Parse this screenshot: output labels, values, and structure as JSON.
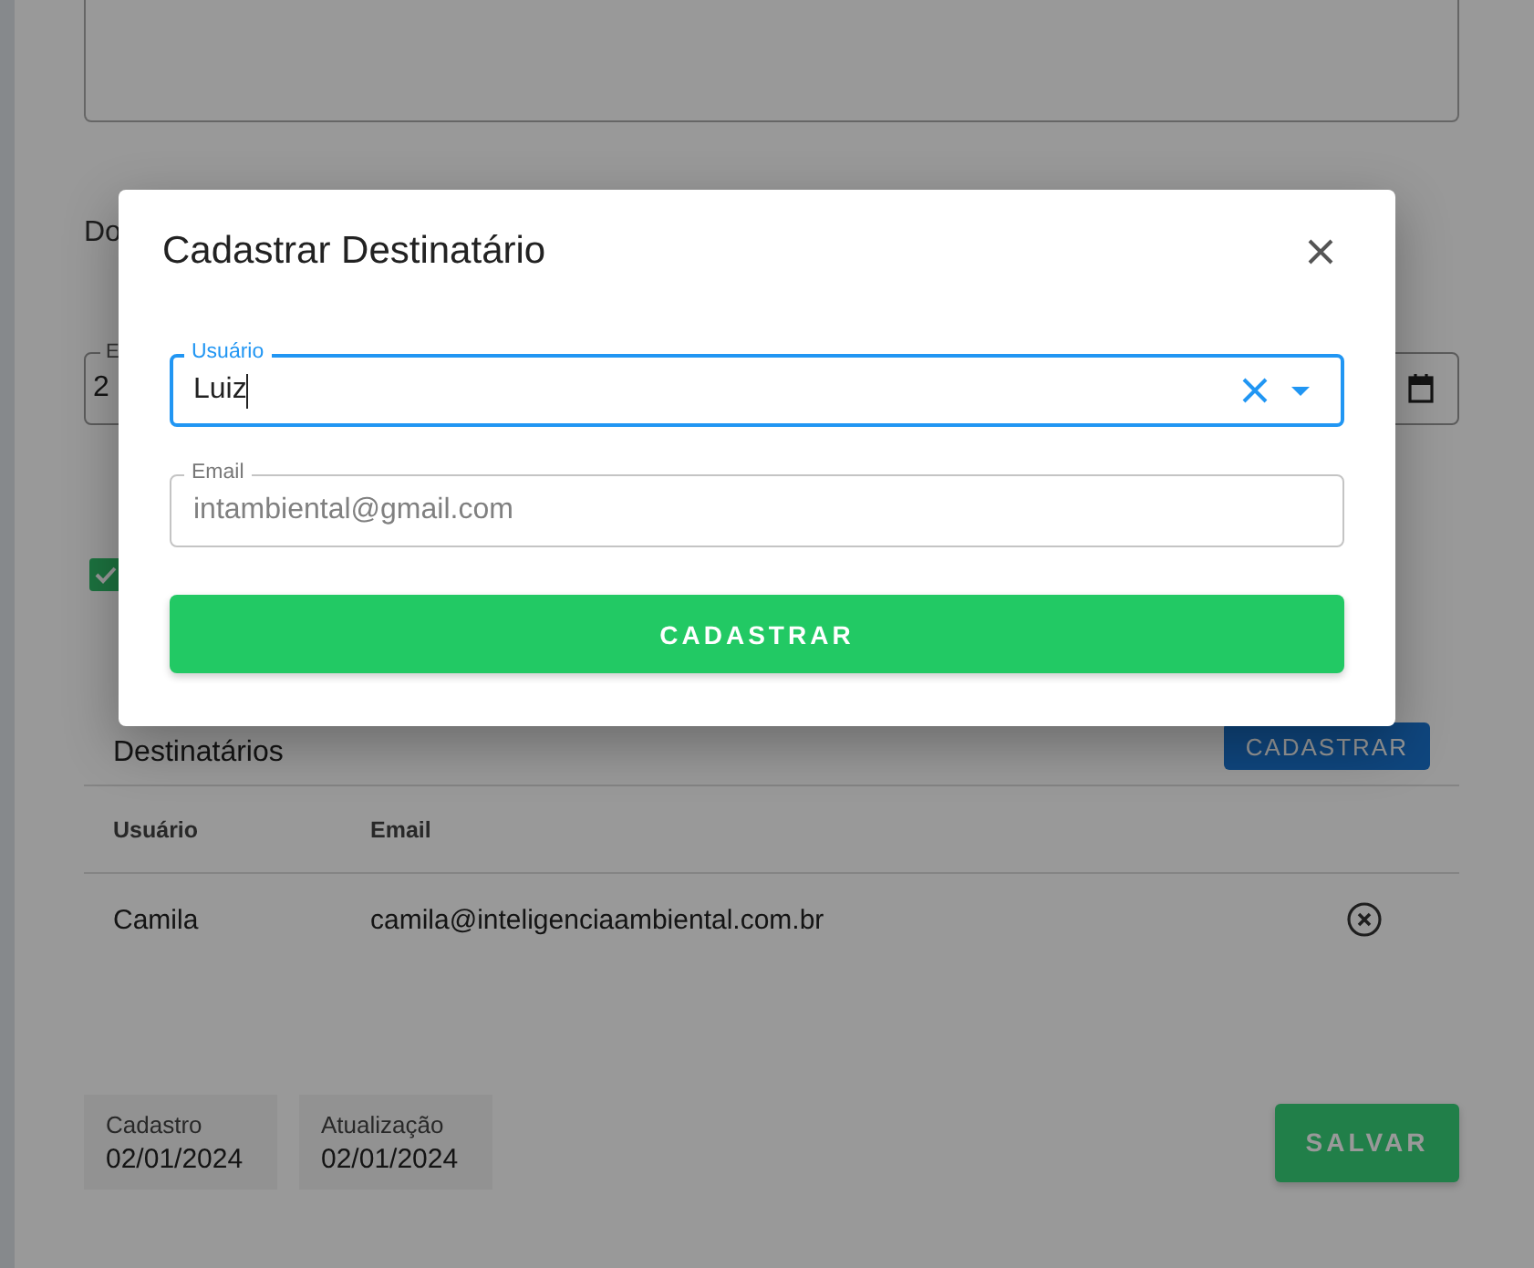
{
  "page": {
    "section_heading": "Do",
    "date_field": {
      "label": "E",
      "value": "2"
    },
    "checkbox": {
      "checked": true
    },
    "recipients": {
      "title": "Destinatários",
      "add_button": "CADASTRAR",
      "columns": [
        "Usuário",
        "Email"
      ],
      "rows": [
        {
          "user": "Camila",
          "email": "camila@inteligenciaambiental.com.br"
        }
      ]
    },
    "created": {
      "label": "Cadastro",
      "value": "02/01/2024"
    },
    "updated": {
      "label": "Atualização",
      "value": "02/01/2024"
    },
    "save_button": "SALVAR"
  },
  "dialog": {
    "title": "Cadastrar Destinatário",
    "user_field": {
      "label": "Usuário",
      "value": "Luiz",
      "focused": true,
      "disabled": false
    },
    "email_field": {
      "label": "Email",
      "value": "intambiental@gmail.com",
      "focused": false,
      "disabled": true
    },
    "submit_button": "CADASTRAR"
  }
}
